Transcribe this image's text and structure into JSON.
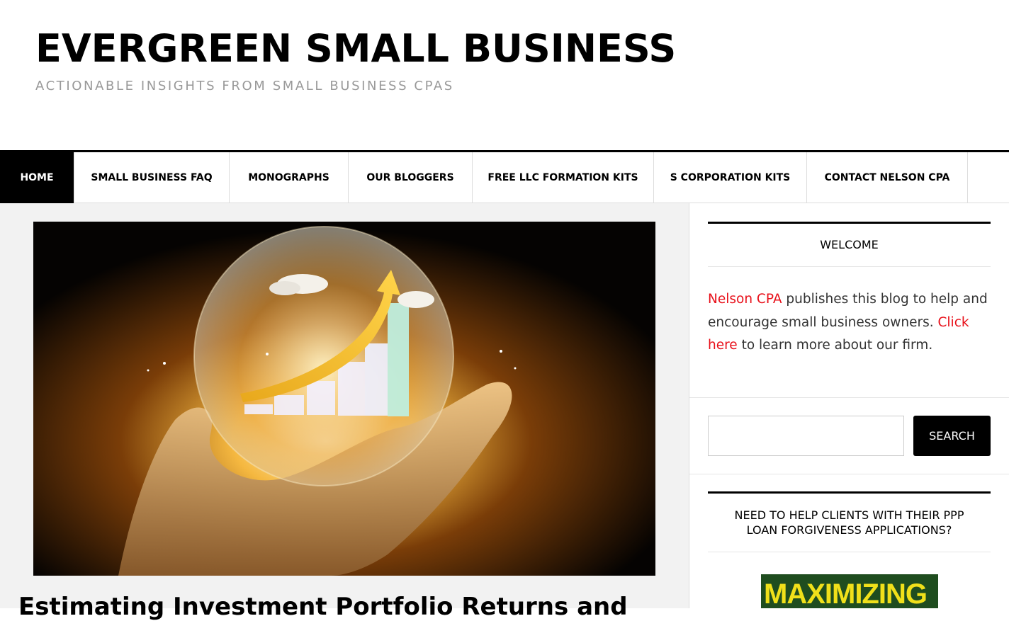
{
  "site": {
    "title": "EVERGREEN SMALL BUSINESS",
    "description": "ACTIONABLE INSIGHTS FROM SMALL BUSINESS CPAS"
  },
  "nav": {
    "items": [
      {
        "label": "HOME",
        "active": true
      },
      {
        "label": "SMALL BUSINESS FAQ"
      },
      {
        "label": "MONOGRAPHS"
      },
      {
        "label": "OUR BLOGGERS"
      },
      {
        "label": "FREE LLC FORMATION KITS"
      },
      {
        "label": "S CORPORATION KITS"
      },
      {
        "label": "CONTACT NELSON CPA"
      }
    ]
  },
  "post": {
    "title": "Estimating Investment Portfolio Returns and"
  },
  "sidebar": {
    "welcome": {
      "title": "WELCOME",
      "link1": "Nelson CPA",
      "text1": " publishes this blog to help and encourage small business owners. ",
      "link2": "Click here",
      "text2": " to learn more about our firm."
    },
    "search": {
      "button_label": "SEARCH",
      "value": ""
    },
    "ppp": {
      "title": "NEED TO HELP CLIENTS WITH THEIR PPP LOAN FORGIVENESS APPLICATIONS?",
      "book_text": "MAXIMIZING"
    }
  },
  "colors": {
    "link": "#e8101a",
    "nav_active_bg": "#000000",
    "content_bg": "#f2f2f2"
  }
}
